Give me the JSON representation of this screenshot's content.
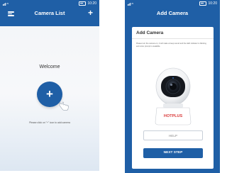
{
  "screen1": {
    "statusbar": {
      "time": "10:20"
    },
    "header": {
      "title": "Camera List",
      "add_icon": "+"
    },
    "welcome": "Welcome",
    "add_button_icon": "+",
    "hint": "Please click on \"+\" icon to add camera"
  },
  "screen2": {
    "statusbar": {
      "time": "10:20"
    },
    "header": {
      "title": "Add Camera"
    },
    "panel": {
      "title": "Add Camera",
      "description": "Please turn the camera on, it will make a beep sound and the LED indicator is blinking and voice prompt is available.",
      "brand": "HOTPLUS",
      "help_label": "HELP",
      "next_label": "NEXT STEP"
    }
  },
  "colors": {
    "primary": "#1f5fa6",
    "brand_red": "#d93a3a"
  }
}
